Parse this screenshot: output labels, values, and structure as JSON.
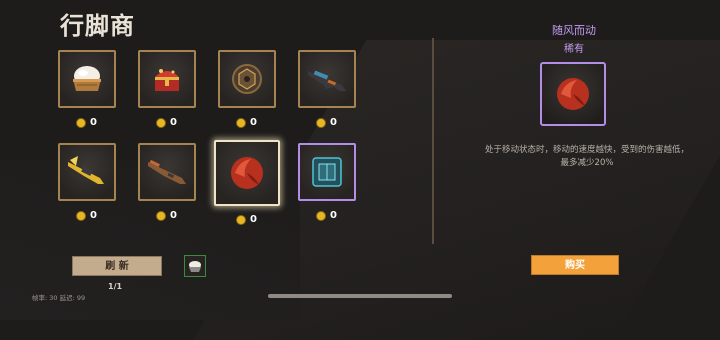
{
  "header": {
    "title": "行脚商"
  },
  "items": [
    {
      "name": "rice-bowl-icon",
      "price": "0",
      "rarity": "common"
    },
    {
      "name": "treasure-chest-icon",
      "price": "0",
      "rarity": "common"
    },
    {
      "name": "hex-nut-icon",
      "price": "0",
      "rarity": "common"
    },
    {
      "name": "dark-rifle-icon",
      "price": "0",
      "rarity": "common"
    },
    {
      "name": "golden-crossbow-icon",
      "price": "0",
      "rarity": "common"
    },
    {
      "name": "brown-rifle-icon",
      "price": "0",
      "rarity": "common"
    },
    {
      "name": "red-orb-icon",
      "price": "0",
      "rarity": "selected"
    },
    {
      "name": "cyan-armor-icon",
      "price": "0",
      "rarity": "epic"
    }
  ],
  "detail": {
    "name": "随风而动",
    "rarity": "稀有",
    "description": "处于移动状态时，移动的速度越快，受到的伤害越低，最多减少20%",
    "icon": "red-orb-icon"
  },
  "actions": {
    "refresh_label": "刷 新",
    "refresh_count": "1/1",
    "buy_label": "购买"
  },
  "footer": {
    "stats": "帧率: 30   延迟: 99"
  },
  "colors": {
    "gold_border": "#a58451",
    "epic": "#b48de6",
    "buy": "#f2a13b",
    "coin": "#e7b623"
  }
}
